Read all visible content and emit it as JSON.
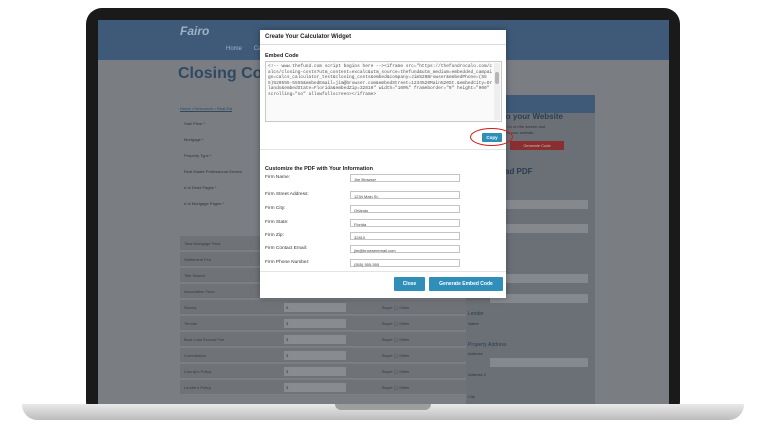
{
  "background": {
    "logo": "Fairo",
    "nav": [
      "Home",
      "Ca"
    ],
    "page_title": "Closing Cost",
    "breadcrumb": "Home • Resources • Real Est",
    "form_labels": [
      "Sale Price *",
      "Mortgage *",
      "Property Type *",
      "Real Estate Professional Service",
      "# of Deed Pages *",
      "# of Mortgage Pages *"
    ],
    "fee_rows": [
      {
        "label": "Total Mortgage Fees",
        "value": ""
      },
      {
        "label": "Settlement Fee",
        "value": ""
      },
      {
        "label": "Title Search",
        "value": ""
      },
      {
        "label": "Association Fees",
        "value": "$"
      },
      {
        "label": "Survey",
        "value": "$"
      },
      {
        "label": "Termite",
        "value": "$"
      },
      {
        "label": "Best Loan Escrow Fee",
        "value": "$"
      },
      {
        "label": "Commission",
        "value": "$"
      },
      {
        "label": "County's Policy",
        "value": "$"
      },
      {
        "label": "Lender's Policy",
        "value": "$"
      }
    ],
    "radio_options": {
      "buyer": "Buyer",
      "seller": "Seller"
    },
    "right_panel": {
      "title": "d to your Website",
      "text_lines": [
        "your own for on the screen and",
        "ent code to your website."
      ],
      "red_button": "Generate Code",
      "subtitle": "nload PDF",
      "sections": {
        "lender": "Lender",
        "lender_name": "Name",
        "property": "Property Address",
        "address": "Address",
        "address2": "Address 2",
        "city": "City",
        "gr_label": "r"
      }
    }
  },
  "modal": {
    "title": "Create Your Calculator Widget",
    "embed_title": "Embed Code",
    "embed_code": "<!-- www.thefund.com script begins here --><iframe src=\"https://thefundrocalo.com/calcs/closing-costs?utm_content=excalc&utm_source=thefund&utm_medium=embedded_campaign=calcs_calculator_test&closing_costs&embed&company=Jim%20Browser&embedPhone=(555)%20555-5555&embedEmail=jim@browser.com&embedStreet=1234%20Main%20St.&embedCity=Orlando&embedState=Florida&embedZip=32810\" width=\"100%\" frameborder=\"0\" height=\"900\" scrolling=\"no\" allowfullscreen></iframe>",
    "copy_label": "Copy",
    "customize_title": "Customize the PDF with Your Information",
    "fields": [
      {
        "label": "Firm Name:",
        "value": "Jim Browser"
      },
      {
        "label": "Firm Street Address:",
        "value": "1234 Main St."
      },
      {
        "label": "Firm City:",
        "value": "Orlando"
      },
      {
        "label": "Firm State:",
        "value": "Florida"
      },
      {
        "label": "Firm Zip:",
        "value": "32810"
      },
      {
        "label": "Firm Contact Email:",
        "value": "jim@browseremail.com"
      },
      {
        "label": "Firm Phone Number:",
        "value": "(555) 555-555"
      }
    ],
    "close_label": "Close",
    "generate_label": "Generate Embed Code"
  },
  "colors": {
    "accent": "#2f8fb8",
    "highlight_ring": "#d11c1c",
    "header": "#3e5a78"
  }
}
